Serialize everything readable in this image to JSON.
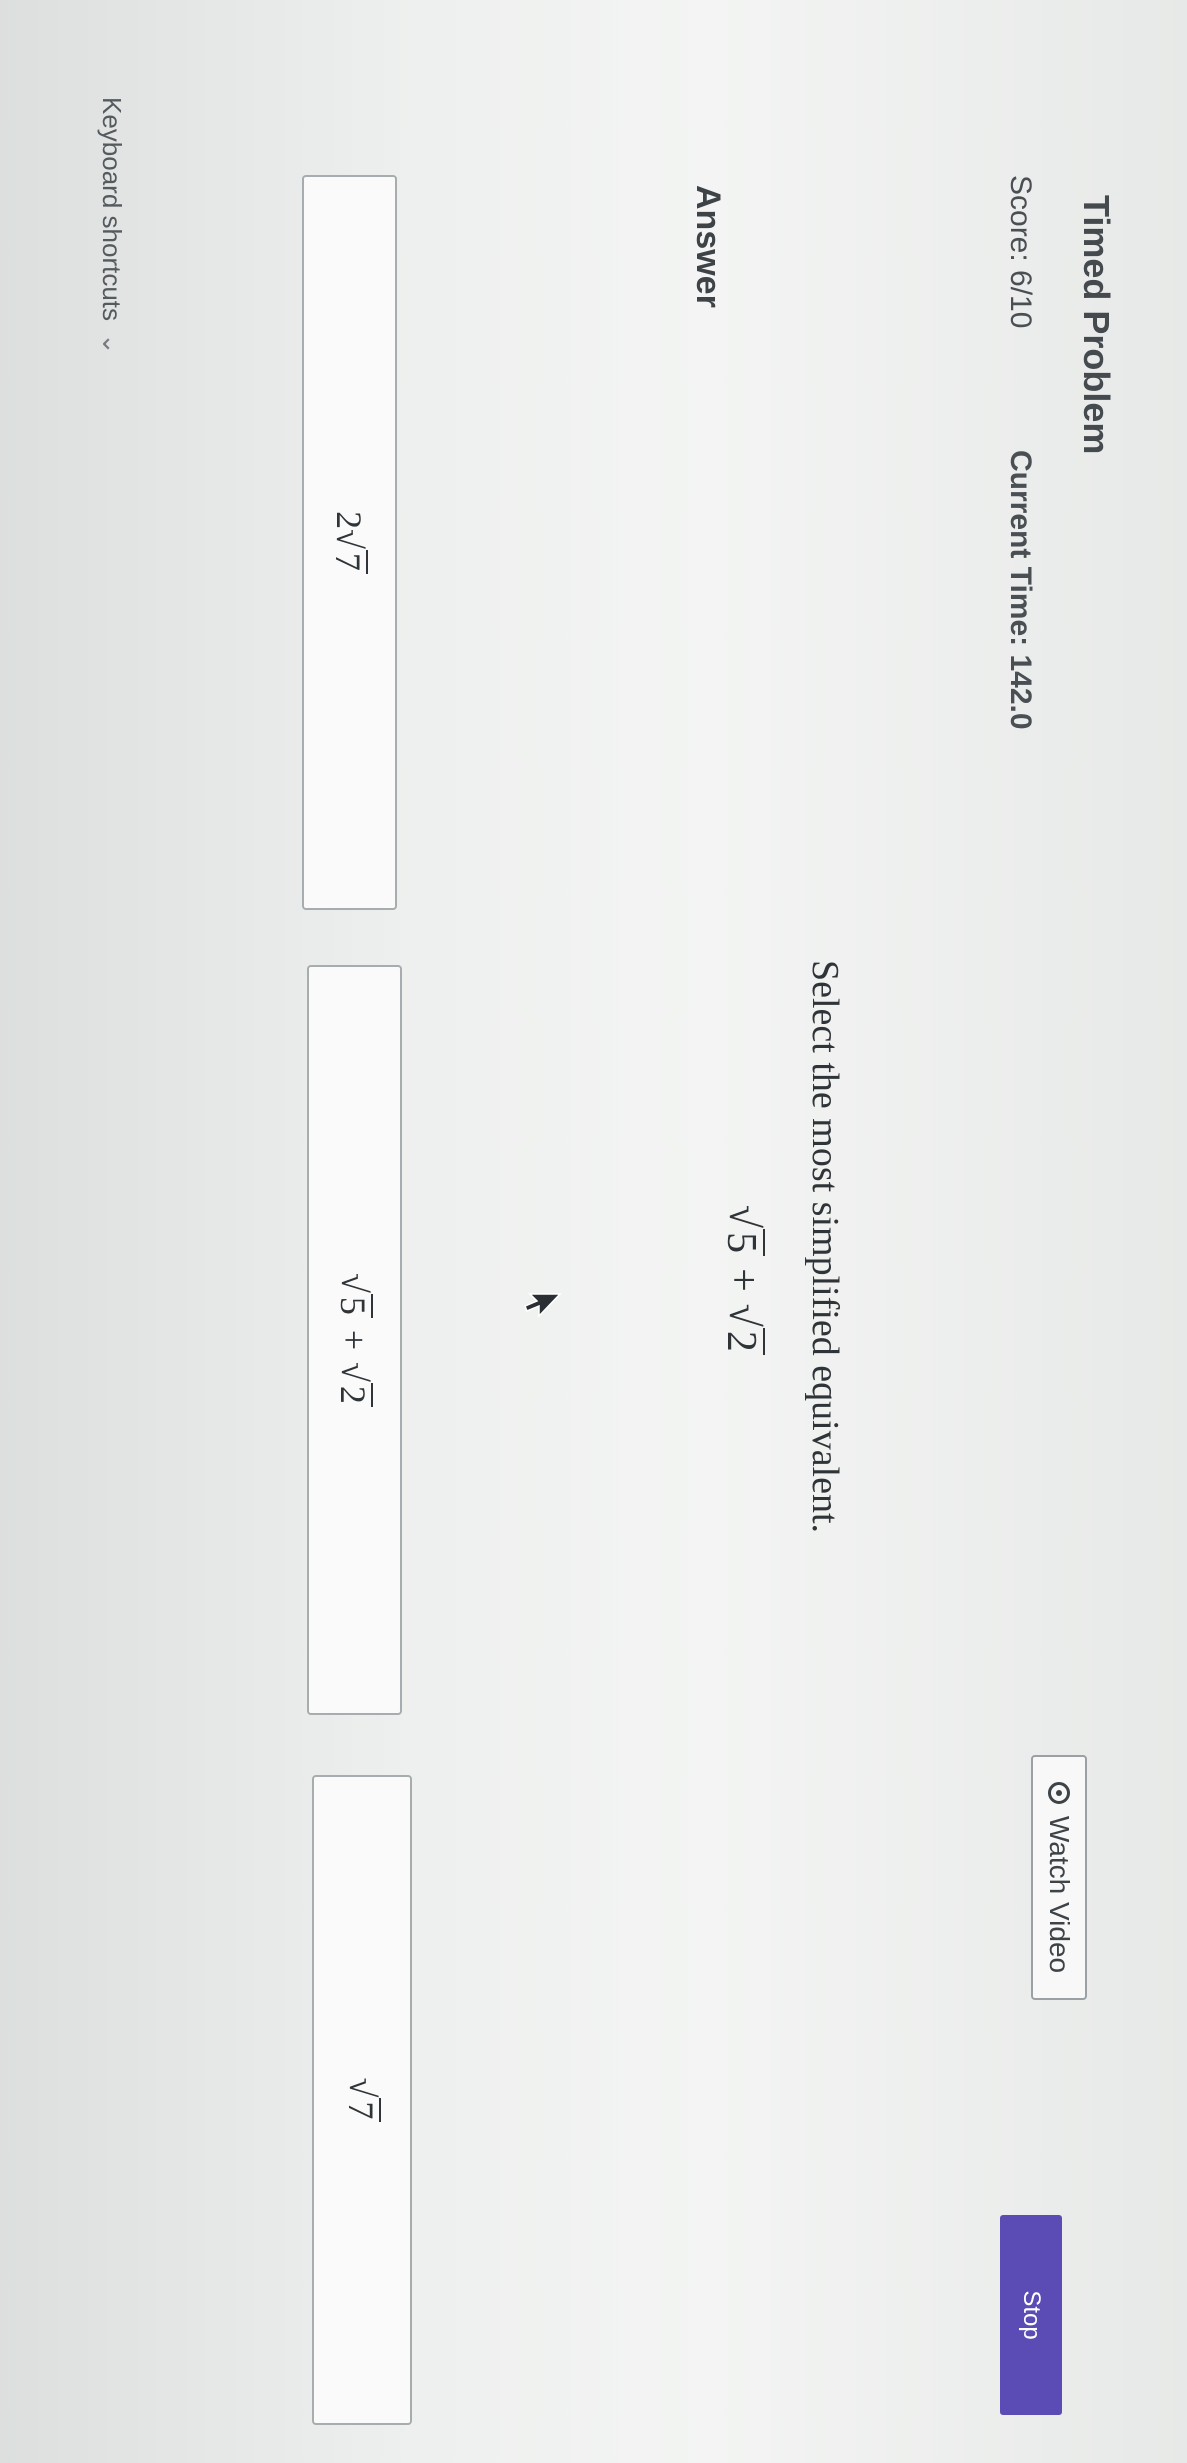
{
  "header": {
    "title": "Timed Problem",
    "score": "Score: 6/10",
    "current_time": "Current Time: 142.0"
  },
  "actions": {
    "watch_video_label": "Watch Video",
    "stop_label": "Stop"
  },
  "problem": {
    "prompt": "Select the most simplified equivalent.",
    "expression": {
      "radicand_a": "5",
      "operator": "+",
      "radicand_b": "2"
    }
  },
  "answer": {
    "label": "Answer",
    "choices": [
      {
        "coefficient": "2",
        "radicand": "7"
      },
      {
        "radicand_a": "5",
        "operator": "+",
        "radicand_b": "2"
      },
      {
        "radicand": "7"
      }
    ]
  },
  "footer": {
    "keyboard_shortcuts_label": "Keyboard shortcuts"
  },
  "colors": {
    "stop_button": "#5a4bb5",
    "background": "#eef0ef"
  }
}
